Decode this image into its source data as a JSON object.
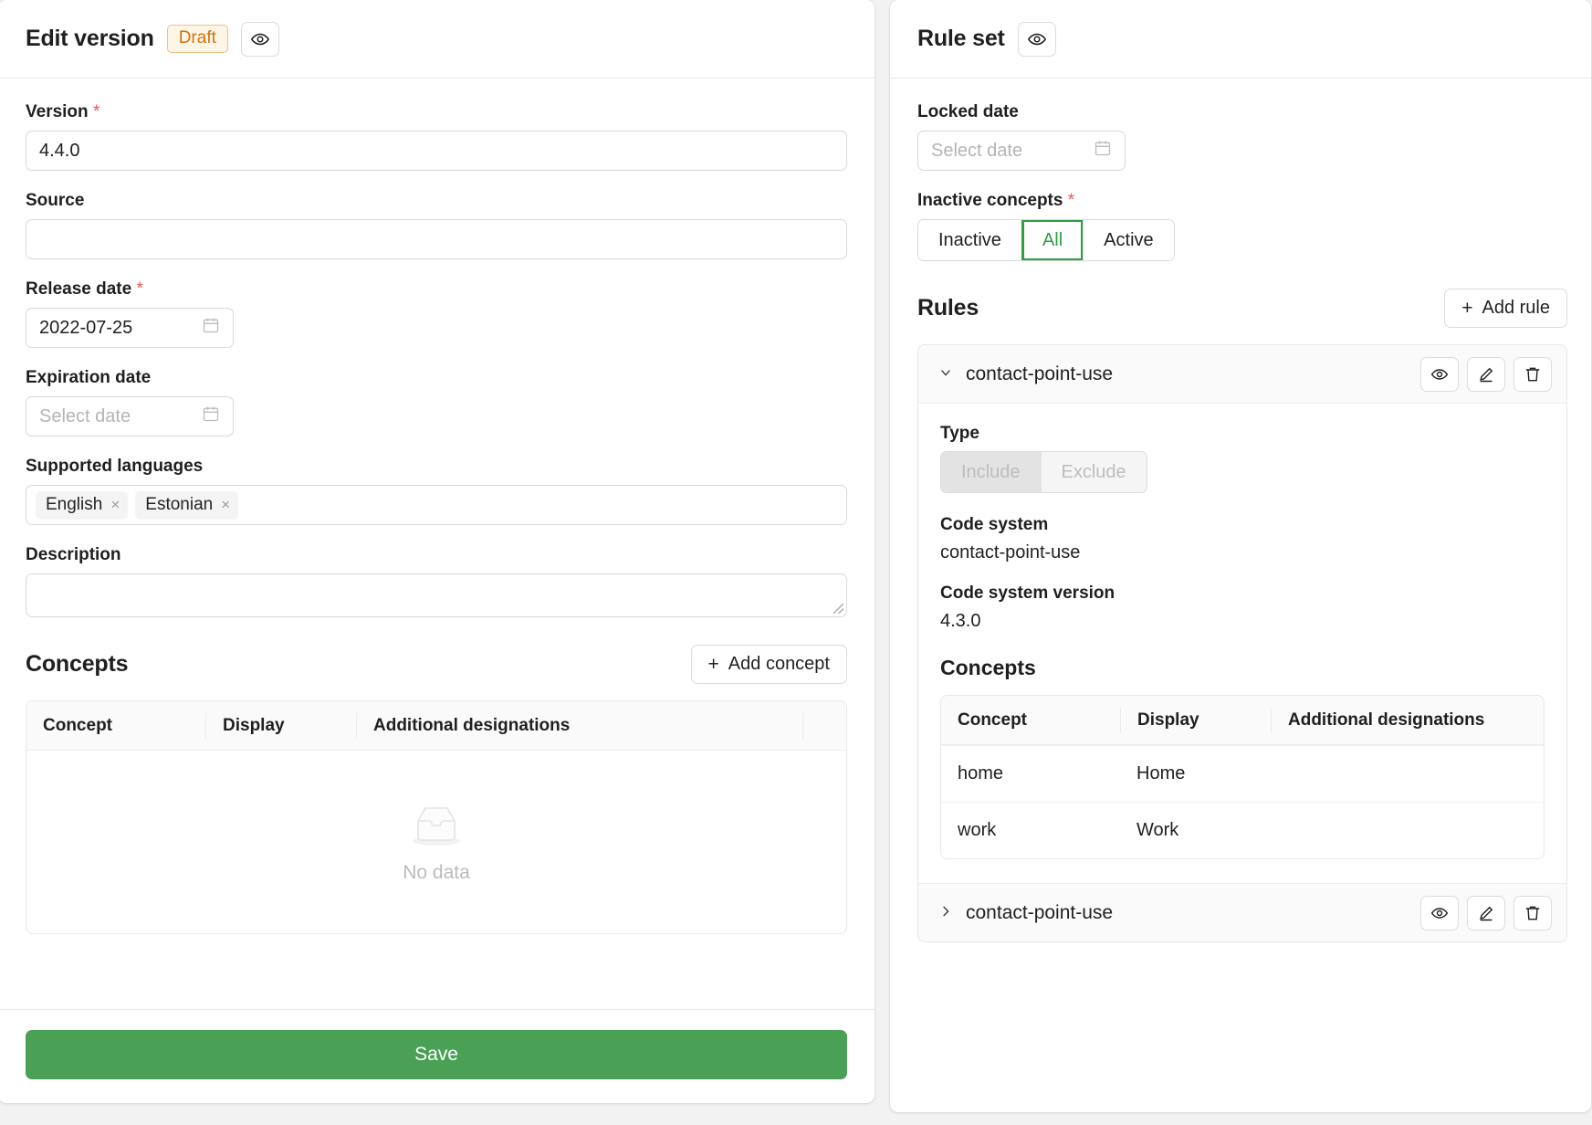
{
  "left_panel": {
    "title": "Edit version",
    "status_badge": "Draft",
    "preview_icon": "eye-icon",
    "fields": {
      "version": {
        "label": "Version",
        "required": true,
        "value": "4.4.0"
      },
      "source": {
        "label": "Source",
        "required": false,
        "value": ""
      },
      "release_date": {
        "label": "Release date",
        "required": true,
        "value": "2022-07-25",
        "placeholder": "Select date"
      },
      "expiration_date": {
        "label": "Expiration date",
        "required": false,
        "value": "",
        "placeholder": "Select date"
      },
      "supported_languages": {
        "label": "Supported languages",
        "tags": [
          "English",
          "Estonian"
        ],
        "remove_glyph": "×"
      },
      "description": {
        "label": "Description",
        "value": ""
      }
    },
    "concepts": {
      "title": "Concepts",
      "add_button": "Add concept",
      "add_icon": "plus-icon",
      "columns": [
        "Concept",
        "Display",
        "Additional designations"
      ],
      "rows": [],
      "empty_text": "No data",
      "empty_icon": "empty-box-icon"
    },
    "save_label": "Save",
    "save_color": "#4aa055"
  },
  "right_panel": {
    "title": "Rule set",
    "preview_icon": "eye-icon",
    "locked_date": {
      "label": "Locked date",
      "value": "",
      "placeholder": "Select date"
    },
    "inactive_concepts": {
      "label": "Inactive concepts",
      "required": true,
      "options": [
        "Inactive",
        "All",
        "Active"
      ],
      "selected": "All",
      "active_color": "#2f9e44"
    },
    "rules_section": {
      "title": "Rules",
      "add_button": "Add rule",
      "add_icon": "plus-icon"
    },
    "rules": [
      {
        "name": "contact-point-use",
        "expanded": true,
        "caret_glyph": "⌄",
        "actions": [
          "eye-icon",
          "pencil-icon",
          "trash-icon"
        ],
        "type": {
          "label": "Type",
          "options": [
            "Include",
            "Exclude"
          ],
          "selected": "Include",
          "disabled": true
        },
        "code_system": {
          "label": "Code system",
          "value": "contact-point-use"
        },
        "code_system_version": {
          "label": "Code system version",
          "value": "4.3.0"
        },
        "concepts": {
          "title": "Concepts",
          "columns": [
            "Concept",
            "Display",
            "Additional designations"
          ],
          "rows": [
            {
              "concept": "home",
              "display": "Home",
              "additional": ""
            },
            {
              "concept": "work",
              "display": "Work",
              "additional": ""
            }
          ]
        }
      },
      {
        "name": "contact-point-use",
        "expanded": false,
        "caret_glyph": "›",
        "actions": [
          "eye-icon",
          "pencil-icon",
          "trash-icon"
        ]
      }
    ]
  }
}
